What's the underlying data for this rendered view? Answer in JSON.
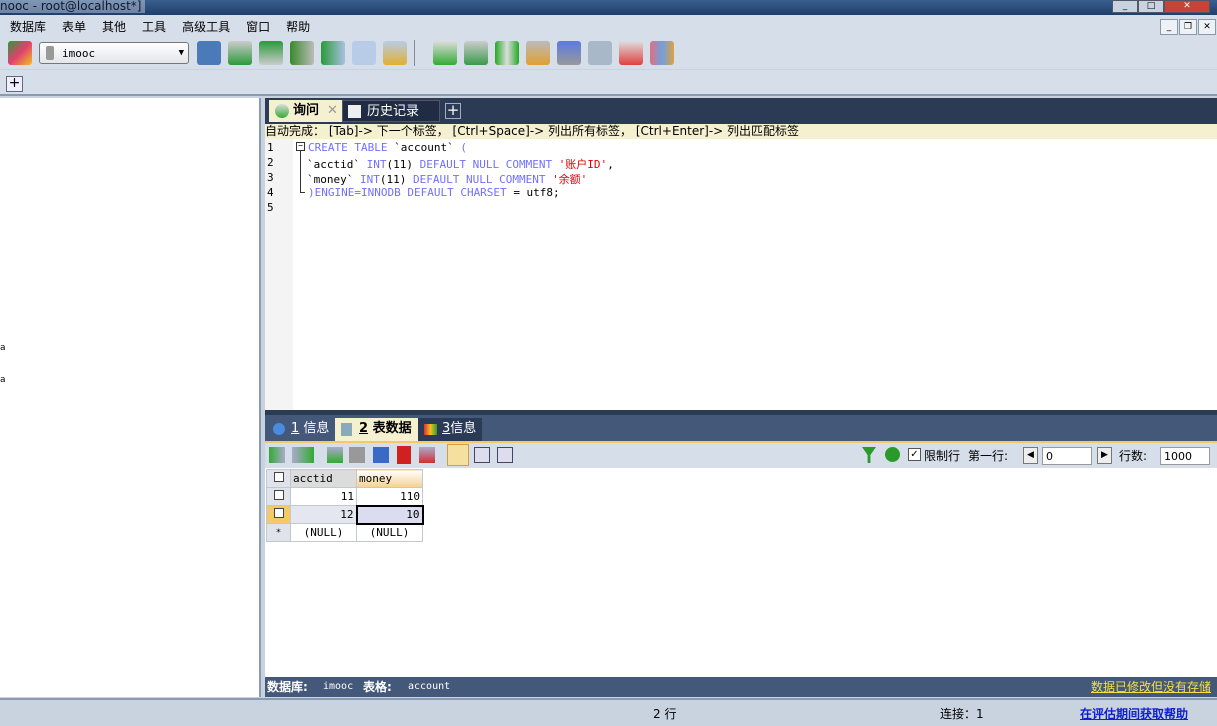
{
  "window": {
    "title": "nooc - root@localhost*]"
  },
  "menu": [
    "数据库",
    "表单",
    "其他",
    "工具",
    "高级工具",
    "窗口",
    "帮助"
  ],
  "toolbar": {
    "database_select": "imooc"
  },
  "query_tabs": [
    {
      "label": "询问",
      "active": true
    },
    {
      "label": "历史记录",
      "active": false
    }
  ],
  "autocomplete_hint": "自动完成：  [Tab]-> 下一个标签， [Ctrl+Space]-> 列出所有标签， [Ctrl+Enter]-> 列出匹配标签",
  "editor": {
    "line_numbers": [
      "1",
      "2",
      "3",
      "4",
      "5"
    ],
    "lines": [
      [
        {
          "t": "CREATE TABLE ",
          "c": "kw"
        },
        {
          "t": "`account` ",
          "c": ""
        },
        {
          "t": "(",
          "c": "kw"
        }
      ],
      [
        {
          "t": "`acctid` ",
          "c": ""
        },
        {
          "t": "INT",
          "c": "kw"
        },
        {
          "t": "(11) ",
          "c": ""
        },
        {
          "t": "DEFAULT NULL COMMENT ",
          "c": "kw"
        },
        {
          "t": "'账户ID'",
          "c": "str"
        },
        {
          "t": ",",
          "c": ""
        }
      ],
      [
        {
          "t": "`money` ",
          "c": ""
        },
        {
          "t": "INT",
          "c": "kw"
        },
        {
          "t": "(11) ",
          "c": ""
        },
        {
          "t": "DEFAULT NULL COMMENT ",
          "c": "kw"
        },
        {
          "t": "'余额'",
          "c": "str"
        }
      ],
      [
        {
          "t": ")ENGINE=INNODB DEFAULT CHARSET ",
          "c": "kw"
        },
        {
          "t": "= utf8;",
          "c": ""
        }
      ],
      []
    ]
  },
  "result_tabs": [
    {
      "num": "1",
      "label": "信息"
    },
    {
      "num": "2",
      "label": "表数据",
      "active": true
    },
    {
      "num": "3",
      "label": "信息"
    }
  ],
  "result_toolbar": {
    "limit_label": "限制行",
    "limit_checked": true,
    "first_row_label": "第一行:",
    "first_row_value": "0",
    "rows_label": "行数:",
    "rows_value": "1000"
  },
  "grid": {
    "columns": [
      "acctid",
      "money"
    ],
    "rows": [
      [
        "11",
        "110"
      ],
      [
        "12",
        "10"
      ],
      [
        "(NULL)",
        "(NULL)"
      ]
    ],
    "new_row_marker": "*"
  },
  "status": {
    "db_label": "数据库:",
    "db_value": "imooc",
    "table_label": "表格:",
    "table_value": "account",
    "warning": "数据已修改但没有存储"
  },
  "bottom": {
    "rows": "2 行",
    "connection": "连接：1",
    "help_link": "在评估期间获取帮助"
  },
  "left_pane": {
    "items": [
      "a",
      "a"
    ]
  }
}
